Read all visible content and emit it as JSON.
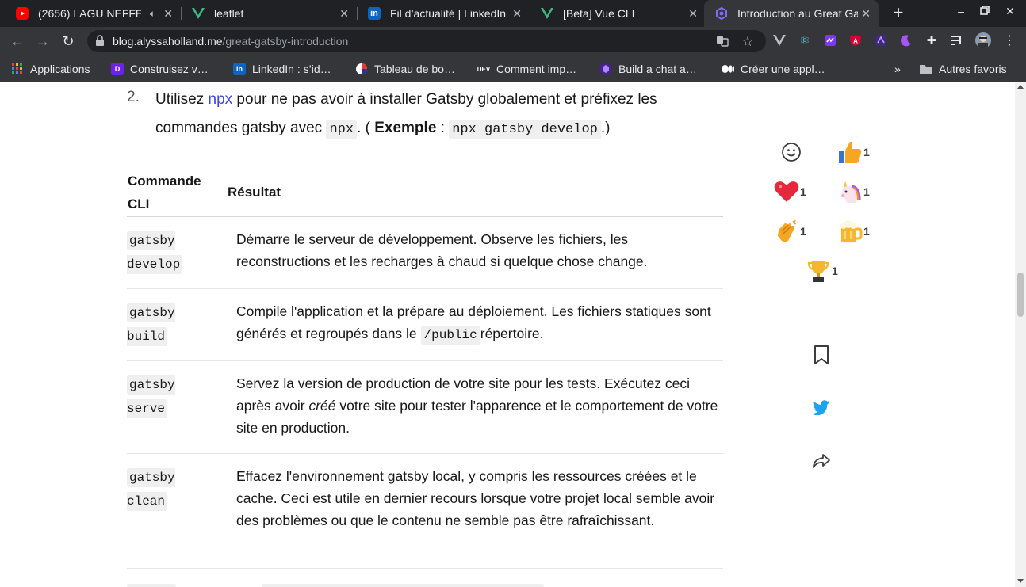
{
  "tabs": [
    {
      "title": "(2656) LAGU NEFFE",
      "icon": "youtube-icon"
    },
    {
      "title": "leaflet",
      "icon": "vue-icon"
    },
    {
      "title": "Fil d’actualité | LinkedIn",
      "icon": "linkedin-icon"
    },
    {
      "title": "[Beta] Vue CLI",
      "icon": "vue-icon"
    },
    {
      "title": "Introduction au Great Gatsby",
      "icon": "gatsby-icon"
    }
  ],
  "address_bar": {
    "domain": "blog.alyssaholland.me",
    "path": "/great-gatsby-introduction"
  },
  "bookmarks": [
    {
      "label": "Applications",
      "icon": "apps-grid-icon"
    },
    {
      "label": "Construisez v…",
      "icon": "bookmark-purple-icon"
    },
    {
      "label": "LinkedIn : s’id…",
      "icon": "linkedin-icon"
    },
    {
      "label": "Tableau de bo…",
      "icon": "dashboard-icon"
    },
    {
      "label": "Comment imp…",
      "icon": "dev-icon"
    },
    {
      "label": "Build a chat a…",
      "icon": "chat-app-icon"
    },
    {
      "label": "Créer une appl…",
      "icon": "medium-icon"
    },
    {
      "label": "Autres favoris",
      "icon": "folder-icon"
    }
  ],
  "article": {
    "list_number": "2.",
    "list_text_1": "Utilisez ",
    "list_link": "npx",
    "list_text_2": " pour ne pas avoir à installer Gatsby globalement et préfixez les commandes gatsby avec ",
    "code_npx": "npx",
    "list_text_3": ". ( ",
    "example_label": "Exemple",
    "list_text_4": " : ",
    "code_example": "npx gatsby develop",
    "list_text_5": ".)",
    "table": {
      "header_command": "Commande CLI",
      "header_result": "Résultat",
      "rows": [
        {
          "cmd": "gatsby develop",
          "desc": "Démarre le serveur de développement. Observe les fichiers, les reconstructions et les recharges à chaud si quelque chose change."
        },
        {
          "cmd": "gatsby build",
          "desc_1": "Compile l'application et la prépare au déploiement. Les fichiers statiques sont générés et regroupés dans le ",
          "desc_code": "/public",
          "desc_2": "répertoire."
        },
        {
          "cmd": "gatsby serve",
          "desc_1": "Servez la version de production de votre site pour les tests. Exécutez ceci après avoir ",
          "desc_em": "créé",
          "desc_2": " votre site pour tester l'apparence et le comportement de votre site en production."
        },
        {
          "cmd": "gatsby clean",
          "desc": "Effacez l'environnement gatsby local, y compris les ressources créées et le cache. Ceci est utile en dernier recours lorsque votre projet local semble avoir des problèmes ou que le contenu ne semble pas être rafraîchissant."
        }
      ]
    }
  },
  "reactions": [
    {
      "name": "add-reaction",
      "count": ""
    },
    {
      "name": "thumbs-up",
      "count": "1"
    },
    {
      "name": "heart",
      "count": "1"
    },
    {
      "name": "unicorn",
      "count": "1"
    },
    {
      "name": "clap",
      "count": "1"
    },
    {
      "name": "beer",
      "count": "1"
    },
    {
      "name": "trophy",
      "count": "1"
    }
  ],
  "colors": {
    "accent": "#3b49df",
    "chrome_dark": "#202124",
    "chrome": "#35363a"
  }
}
